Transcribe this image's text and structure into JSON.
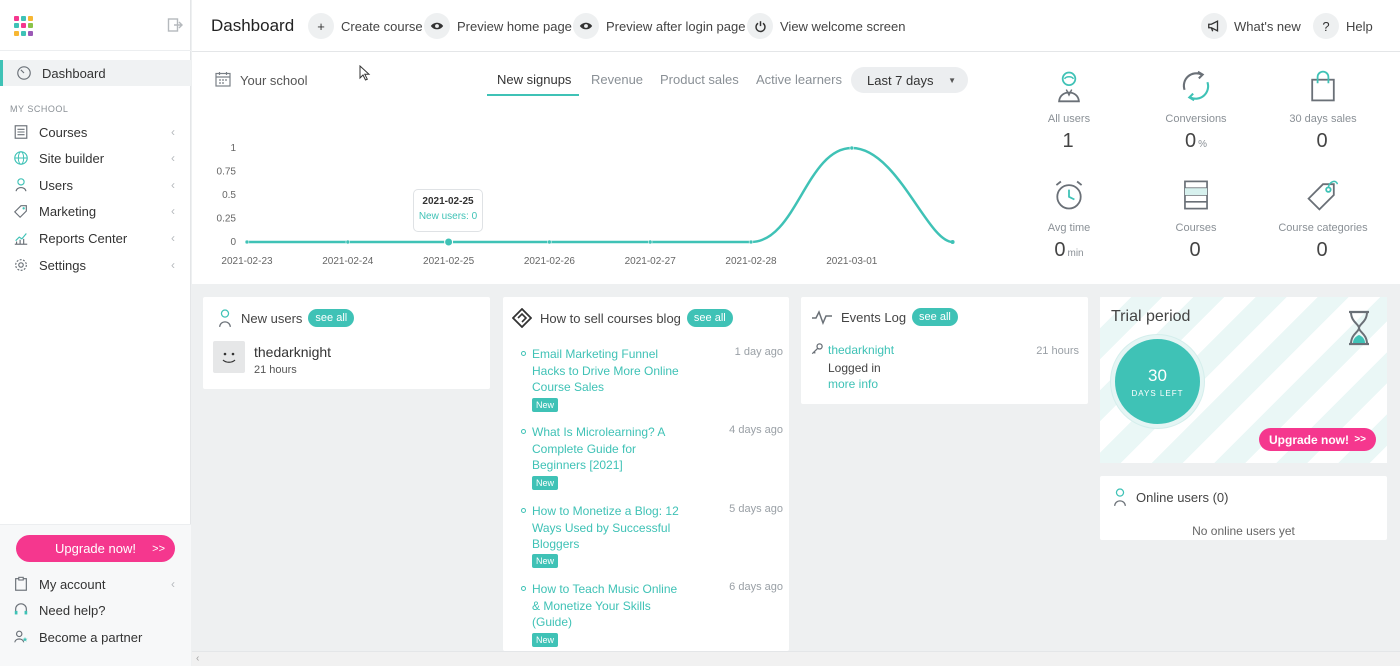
{
  "colors": {
    "accent": "#3fc2b6",
    "pink": "#f5378e"
  },
  "sidebar": {
    "section_label": "MY SCHOOL",
    "dashboard": "Dashboard",
    "items": [
      {
        "label": "Courses",
        "icon": "courses-icon"
      },
      {
        "label": "Site builder",
        "icon": "globe-icon"
      },
      {
        "label": "Users",
        "icon": "user-icon"
      },
      {
        "label": "Marketing",
        "icon": "tag-icon"
      },
      {
        "label": "Reports Center",
        "icon": "chart-icon"
      },
      {
        "label": "Settings",
        "icon": "gear-icon"
      }
    ],
    "upgrade": "Upgrade now!",
    "upgrade_arrow": ">>",
    "bottom_items": [
      "My account",
      "Need help?",
      "Become a partner"
    ]
  },
  "topbar": {
    "title": "Dashboard",
    "create": "Create course",
    "preview_home": "Preview home page",
    "preview_login": "Preview after login page",
    "welcome": "View welcome screen",
    "whats_new": "What's new",
    "help": "Help",
    "help_glyph": "?"
  },
  "stats": {
    "school": "Your school",
    "tabs": [
      "New signups",
      "Revenue",
      "Product sales",
      "Active learners"
    ],
    "range": "Last 7 days",
    "tooltip_date": "2021-02-25",
    "tooltip_value": "New users: 0",
    "tiles": [
      {
        "label": "All users",
        "value": "1",
        "unit": ""
      },
      {
        "label": "Conversions",
        "value": "0",
        "unit": "%"
      },
      {
        "label": "30 days sales",
        "value": "0",
        "unit": ""
      },
      {
        "label": "Avg time",
        "value": "0",
        "unit": "min"
      },
      {
        "label": "Courses",
        "value": "0",
        "unit": ""
      },
      {
        "label": "Course categories",
        "value": "0",
        "unit": ""
      }
    ]
  },
  "chart_data": {
    "type": "line",
    "x": [
      "2021-02-23",
      "2021-02-24",
      "2021-02-25",
      "2021-02-26",
      "2021-02-27",
      "2021-02-28",
      "2021-03-01"
    ],
    "values": [
      0,
      0,
      0,
      0,
      0,
      0,
      1
    ],
    "yticks": [
      "0",
      "0.25",
      "0.5",
      "0.75",
      "1"
    ],
    "ylim": [
      0,
      1
    ],
    "grid": false
  },
  "new_users": {
    "title": "New users",
    "see_all": "see all",
    "user": "thedarknight",
    "time": "21 hours"
  },
  "blog": {
    "title": "How to sell courses blog",
    "see_all": "see all",
    "new_badge": "New",
    "posts": [
      {
        "title": "Email Marketing Funnel Hacks to Drive More Online Course Sales",
        "ago": "1 day ago"
      },
      {
        "title": "What Is Microlearning? A Complete Guide for Beginners [2021]",
        "ago": "4 days ago"
      },
      {
        "title": "How to Monetize a Blog: 12 Ways Used by Successful Bloggers",
        "ago": "5 days ago"
      },
      {
        "title": "How to Teach Music Online & Monetize Your Skills (Guide)",
        "ago": "6 days ago"
      }
    ]
  },
  "events": {
    "title": "Events Log",
    "see_all": "see all",
    "user": "thedarknight",
    "time": "21 hours",
    "action": "Logged in",
    "more": "more info"
  },
  "trial": {
    "title": "Trial period",
    "days": "30",
    "days_label": "DAYS LEFT",
    "button": "Upgrade now!",
    "button_arrow": ">>"
  },
  "online": {
    "title": "Online users (0)",
    "empty": "No online users yet"
  }
}
